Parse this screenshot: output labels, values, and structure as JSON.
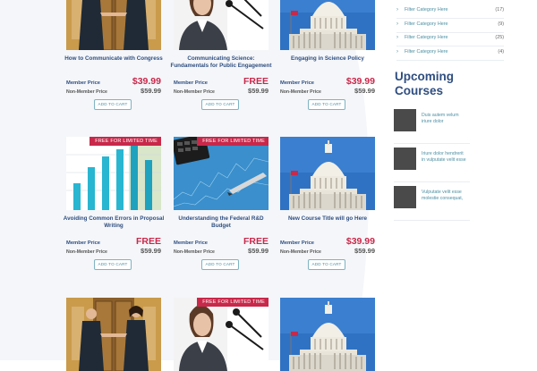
{
  "courses": [
    {
      "title": "How to Communicate with Congress",
      "image": "handshake-photo",
      "ribbon": "",
      "member_label": "Member Price",
      "member_price": "$39.99",
      "nonmember_label": "Non-Member Price",
      "nonmember_price": "$59.99",
      "cart_label": "ADD TO CART"
    },
    {
      "title": "Communicating Science: Fundamentals for Public Engagement",
      "image": "speaker-microphone-photo",
      "ribbon": "",
      "member_label": "Member Price",
      "member_price": "FREE",
      "nonmember_label": "Non-Member Price",
      "nonmember_price": "$59.99",
      "cart_label": "ADD TO CART"
    },
    {
      "title": "Engaging in Science Policy",
      "image": "capitol-photo",
      "ribbon": "",
      "member_label": "Member Price",
      "member_price": "$39.99",
      "nonmember_label": "Non-Member Price",
      "nonmember_price": "$59.99",
      "cart_label": "ADD TO CART"
    },
    {
      "title": "Avoiding Common Errors in Proposal Writing",
      "image": "bar-graph-photo",
      "ribbon": "FREE FOR LIMITED TIME",
      "member_label": "Member Price",
      "member_price": "FREE",
      "nonmember_label": "Non-Member Price",
      "nonmember_price": "$59.99",
      "cart_label": "ADD TO CART"
    },
    {
      "title": "Understanding the Federal R&D Budget",
      "image": "calculator-chart-photo",
      "ribbon": "FREE FOR LIMITED TIME",
      "member_label": "Member Price",
      "member_price": "FREE",
      "nonmember_label": "Non-Member Price",
      "nonmember_price": "$59.99",
      "cart_label": "ADD TO CART"
    },
    {
      "title": "New Course Title will go Here",
      "image": "capitol-photo",
      "ribbon": "",
      "member_label": "Member Price",
      "member_price": "$39.99",
      "nonmember_label": "Non-Member Price",
      "nonmember_price": "$59.99",
      "cart_label": "ADD TO CART"
    },
    {
      "title": "",
      "image": "handshake-photo",
      "ribbon": "",
      "member_label": "",
      "member_price": "",
      "nonmember_label": "",
      "nonmember_price": "",
      "cart_label": ""
    },
    {
      "title": "",
      "image": "speaker-microphone-photo",
      "ribbon": "FREE FOR LIMITED TIME",
      "member_label": "",
      "member_price": "",
      "nonmember_label": "",
      "nonmember_price": "",
      "cart_label": ""
    },
    {
      "title": "",
      "image": "capitol-photo",
      "ribbon": "",
      "member_label": "",
      "member_price": "",
      "nonmember_label": "",
      "nonmember_price": "",
      "cart_label": ""
    }
  ],
  "sidebar": {
    "categories": [
      {
        "label": "Filter Category Here",
        "count": "(17)"
      },
      {
        "label": "Filter Category Here",
        "count": "(9)"
      },
      {
        "label": "Filter Category Here",
        "count": "(25)"
      },
      {
        "label": "Filter Category Here",
        "count": "(4)"
      }
    ],
    "upcoming_title_line1": "Upcoming",
    "upcoming_title_line2": "Courses",
    "upcoming": [
      {
        "line1": "Duis autem velum",
        "line2": "iriure dolor"
      },
      {
        "line1": "Iriure dolor hendrerit",
        "line2": "in vulputate velit esse"
      },
      {
        "line1": "Vulputate velit esse",
        "line2": "molestie consequat,"
      }
    ]
  },
  "colors": {
    "accent_red": "#c8284a",
    "title_blue": "#2f4e80",
    "link_teal": "#4b8fa3",
    "background_tint": "#f4f6f9"
  }
}
